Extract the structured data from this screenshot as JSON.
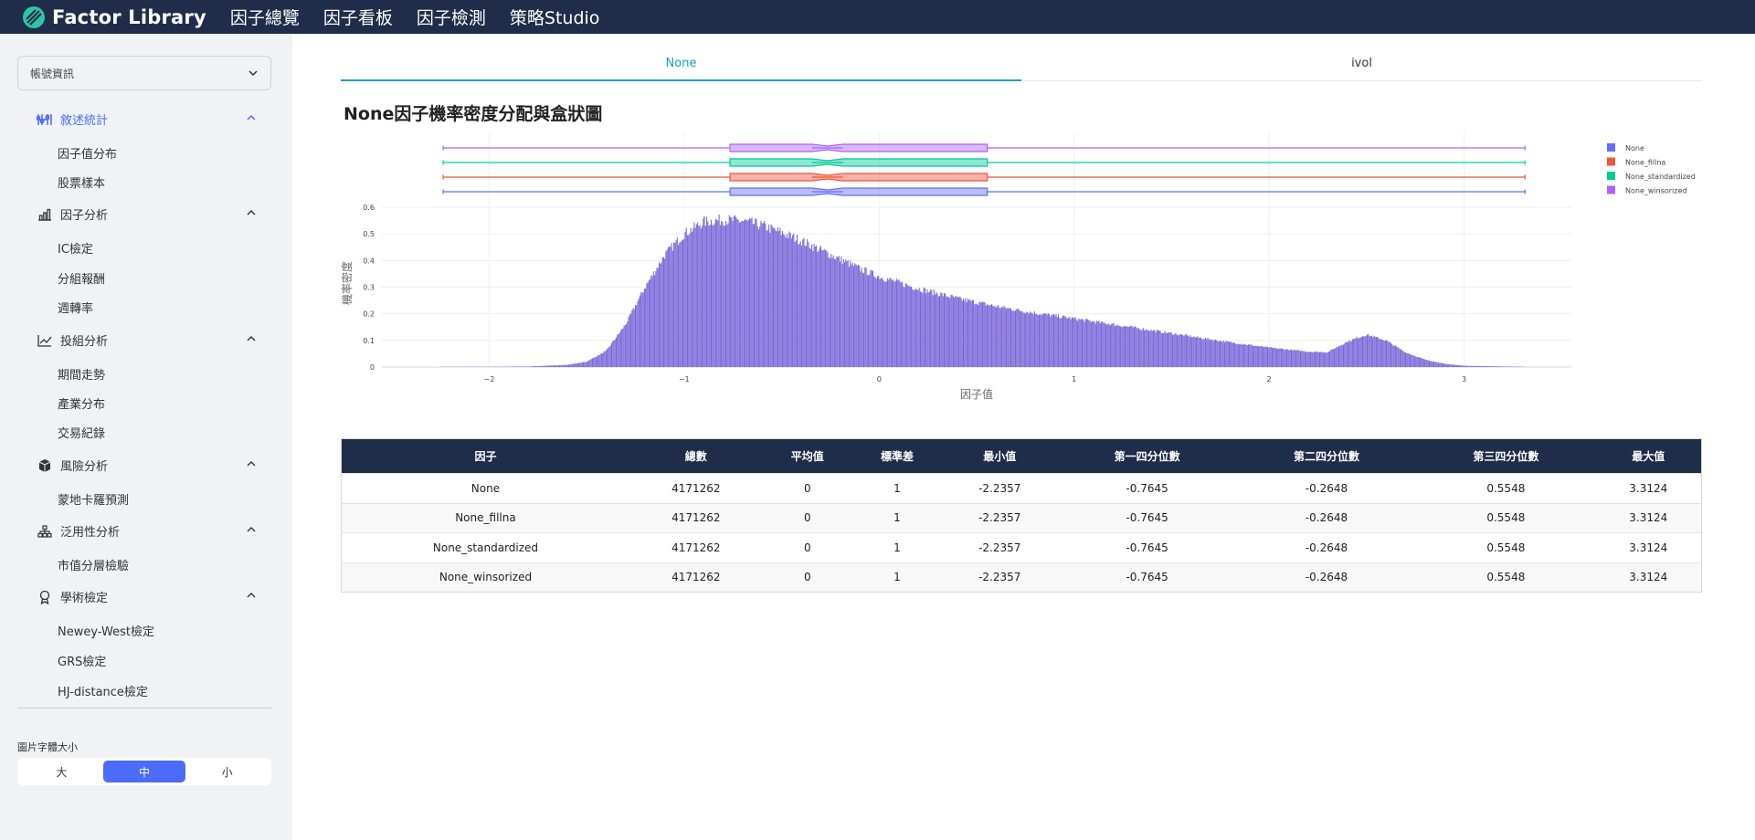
{
  "brand": {
    "name": "Factor Library"
  },
  "nav": [
    "因子總覽",
    "因子看板",
    "因子檢測",
    "策略Studio"
  ],
  "sidebar": {
    "account_select": "帳號資訊",
    "sections": [
      {
        "label": "敘述統計",
        "icon": "sliders-icon",
        "items": [
          "因子值分布",
          "股票樣本"
        ]
      },
      {
        "label": "因子分析",
        "icon": "bar-chart-icon",
        "items": [
          "IC檢定",
          "分組報酬",
          "週轉率"
        ]
      },
      {
        "label": "投組分析",
        "icon": "line-chart-icon",
        "items": [
          "期間走勢",
          "產業分布",
          "交易紀錄"
        ]
      },
      {
        "label": "風險分析",
        "icon": "cube-icon",
        "items": [
          "蒙地卡羅預測"
        ]
      },
      {
        "label": "泛用性分析",
        "icon": "hierarchy-icon",
        "items": [
          "市值分層檢驗"
        ]
      },
      {
        "label": "學術檢定",
        "icon": "award-icon",
        "items": [
          "Newey-West檢定",
          "GRS檢定",
          "HJ-distance檢定"
        ]
      }
    ],
    "font_size_label": "圖片字體大小",
    "font_sizes": [
      "大",
      "中",
      "小"
    ],
    "font_size_selected": "中"
  },
  "tabs": [
    "None",
    "ivol"
  ],
  "active_tab": "None",
  "chart_title": "None因子機率密度分配與盒狀圖",
  "colors": {
    "accent": "#4b6bfb",
    "tab_accent": "#17a2b8",
    "header_bg": "#1f2d4a",
    "histogram": "#7b68d9"
  },
  "chart_data": {
    "type": "histogram",
    "xlabel": "因子值",
    "ylabel": "機率密度",
    "xlim": [
      -2.55,
      3.55
    ],
    "ylim": [
      0,
      0.6
    ],
    "x_ticks": [
      "-2",
      "-1",
      "0",
      "1",
      "2",
      "3"
    ],
    "y_ticks": [
      "0",
      "0.1",
      "0.2",
      "0.3",
      "0.4",
      "0.5",
      "0.6"
    ],
    "legend": [
      {
        "name": "None",
        "color": "#636efa"
      },
      {
        "name": "None_fillna",
        "color": "#ef553b"
      },
      {
        "name": "None_standardized",
        "color": "#00cc96"
      },
      {
        "name": "None_winsorized",
        "color": "#ab63fa"
      }
    ],
    "boxplot": {
      "min": -2.2357,
      "q1": -0.7645,
      "median": -0.2648,
      "q3": 0.5548,
      "max": 3.3124
    },
    "density_points": [
      [
        -2.25,
        0.001
      ],
      [
        -2.0,
        0.001
      ],
      [
        -1.8,
        0.002
      ],
      [
        -1.6,
        0.008
      ],
      [
        -1.5,
        0.02
      ],
      [
        -1.4,
        0.06
      ],
      [
        -1.3,
        0.16
      ],
      [
        -1.2,
        0.3
      ],
      [
        -1.1,
        0.42
      ],
      [
        -1.0,
        0.5
      ],
      [
        -0.9,
        0.545
      ],
      [
        -0.8,
        0.553
      ],
      [
        -0.7,
        0.548
      ],
      [
        -0.6,
        0.532
      ],
      [
        -0.5,
        0.505
      ],
      [
        -0.4,
        0.475
      ],
      [
        -0.3,
        0.44
      ],
      [
        -0.2,
        0.405
      ],
      [
        -0.1,
        0.37
      ],
      [
        0.0,
        0.34
      ],
      [
        0.2,
        0.295
      ],
      [
        0.4,
        0.258
      ],
      [
        0.6,
        0.228
      ],
      [
        0.8,
        0.203
      ],
      [
        1.0,
        0.182
      ],
      [
        1.2,
        0.16
      ],
      [
        1.4,
        0.138
      ],
      [
        1.6,
        0.115
      ],
      [
        1.8,
        0.093
      ],
      [
        2.0,
        0.073
      ],
      [
        2.2,
        0.058
      ],
      [
        2.3,
        0.056
      ],
      [
        2.4,
        0.095
      ],
      [
        2.5,
        0.122
      ],
      [
        2.6,
        0.1
      ],
      [
        2.7,
        0.055
      ],
      [
        2.8,
        0.028
      ],
      [
        2.9,
        0.012
      ],
      [
        3.0,
        0.005
      ],
      [
        3.2,
        0.002
      ],
      [
        3.31,
        0.001
      ]
    ]
  },
  "table": {
    "headers": [
      "因子",
      "總數",
      "平均值",
      "標準差",
      "最小值",
      "第一四分位數",
      "第二四分位數",
      "第三四分位數",
      "最大值"
    ],
    "rows": [
      [
        "None",
        "4171262",
        "0",
        "1",
        "-2.2357",
        "-0.7645",
        "-0.2648",
        "0.5548",
        "3.3124"
      ],
      [
        "None_fillna",
        "4171262",
        "0",
        "1",
        "-2.2357",
        "-0.7645",
        "-0.2648",
        "0.5548",
        "3.3124"
      ],
      [
        "None_standardized",
        "4171262",
        "0",
        "1",
        "-2.2357",
        "-0.7645",
        "-0.2648",
        "0.5548",
        "3.3124"
      ],
      [
        "None_winsorized",
        "4171262",
        "0",
        "1",
        "-2.2357",
        "-0.7645",
        "-0.2648",
        "0.5548",
        "3.3124"
      ]
    ]
  }
}
